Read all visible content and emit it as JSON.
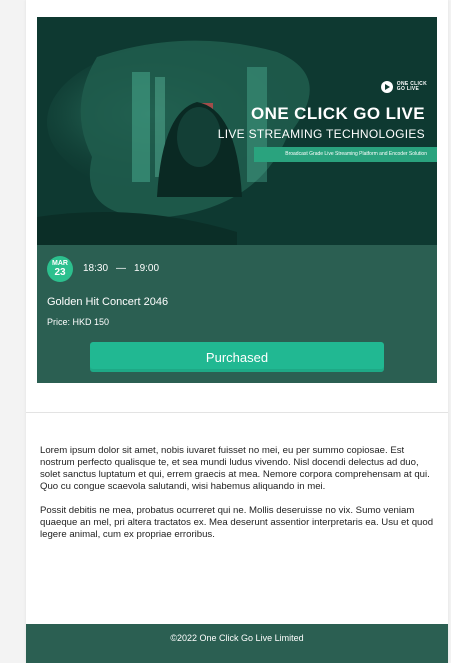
{
  "banner": {
    "brand_text": "ONE CLICK\nGO LIVE",
    "title": "ONE CLICK GO LIVE",
    "subtitle": "LIVE STREAMING TECHNOLOGIES",
    "tagline": "Broadcast Grade Live Streaming Platform and Encoder Solution"
  },
  "event": {
    "month": "MAR",
    "day": "23",
    "start_time": "18:30",
    "separator": "—",
    "end_time": "19:00",
    "title": "Golden Hit Concert 2046",
    "price": "Price: HKD 150",
    "button_label": "Purchased"
  },
  "description": {
    "paragraph_1": "Lorem ipsum dolor sit amet, nobis iuvaret fuisset no mei, eu per summo copiosae. Est nostrum perfecto qualisque te, et sea mundi ludus vivendo. Nisl docendi delectus ad duo, solet sanctus luptatum et qui, errem graecis at mea. Nemore corpora comprehensam at qui. Quo cu congue scaevola salutandi, wisi habemus aliquando in mei.",
    "paragraph_2": "Possit debitis ne mea, probatus ocurreret qui ne. Mollis deseruisse no vix. Sumo veniam quaeque an mel, pri altera tractatos ex. Mea deserunt assentior interpretaris ea. Usu et quod legere animal, cum ex propriae erroribus."
  },
  "footer": {
    "copyright": "©2022 One Click Go Live Limited"
  },
  "colors": {
    "card_bg": "#2b5f52",
    "accent": "#21b892",
    "badge": "#2cc08e",
    "banner_strip": "#2aa37e"
  }
}
